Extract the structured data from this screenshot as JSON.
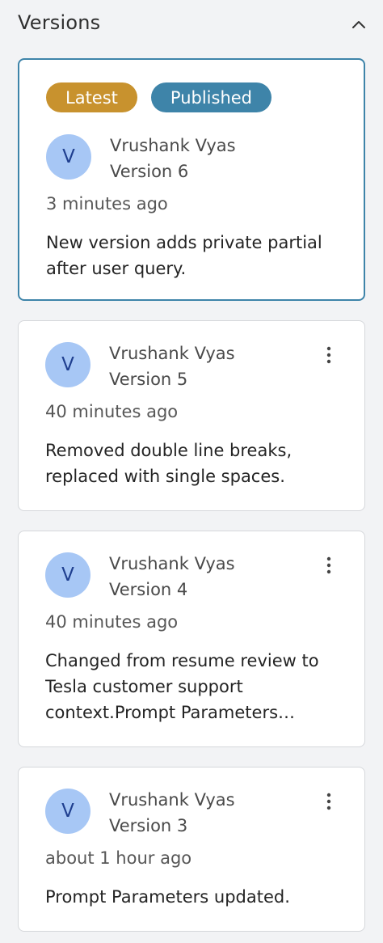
{
  "panel": {
    "title": "Versions"
  },
  "colors": {
    "latest_badge": "#c8922e",
    "published_badge": "#3e84a9",
    "selected_border": "#3e84a9",
    "avatar_bg": "#a7c7f5"
  },
  "versions": [
    {
      "badges": [
        "Latest",
        "Published"
      ],
      "avatar_initial": "V",
      "author": "Vrushank Vyas",
      "version_label": "Version 6",
      "time": "3 minutes ago",
      "description": "New version adds private partial after user query."
    },
    {
      "avatar_initial": "V",
      "author": "Vrushank Vyas",
      "version_label": "Version 5",
      "time": "40 minutes ago",
      "description": "Removed double line breaks, replaced with single spaces."
    },
    {
      "avatar_initial": "V",
      "author": "Vrushank Vyas",
      "version_label": "Version 4",
      "time": "40 minutes ago",
      "description": "Changed from resume review to Tesla customer support context.Prompt Parameters…"
    },
    {
      "avatar_initial": "V",
      "author": "Vrushank Vyas",
      "version_label": "Version 3",
      "time": "about 1 hour ago",
      "description": "Prompt Parameters updated."
    }
  ]
}
